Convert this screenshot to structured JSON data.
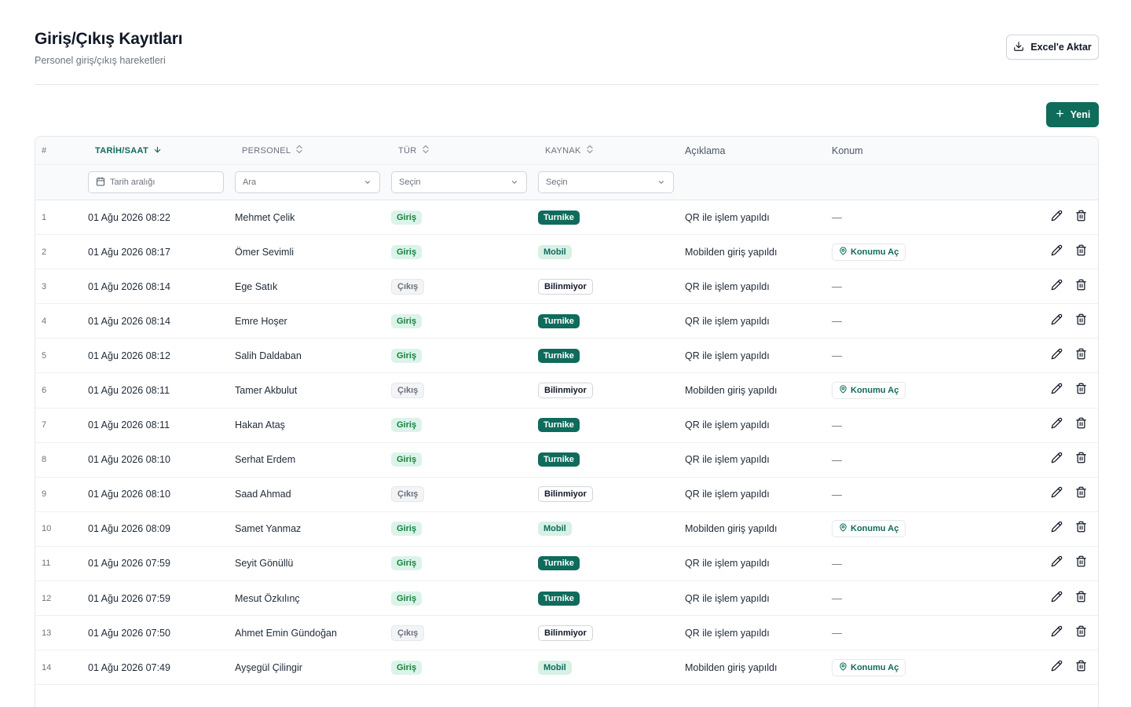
{
  "header": {
    "title": "Giriş/Çıkış Kayıtları",
    "subtitle": "Personel giriş/çıkış hareketleri",
    "export_label": "Excel'e Aktar",
    "new_label": "Yeni"
  },
  "columns": {
    "index": "#",
    "datetime": "TARİH/SAAT",
    "person": "PERSONEL",
    "type": "TÜR",
    "source": "KAYNAK",
    "description": "Açıklama",
    "location": "Konum"
  },
  "filters": {
    "date_placeholder": "Tarih aralığı",
    "person_placeholder": "Ara",
    "type_placeholder": "Seçin",
    "source_placeholder": "Seçin"
  },
  "icons": {
    "export": "download-icon",
    "new": "plus-icon",
    "sort_active": "arrow-down-icon",
    "sort": "sort-icon",
    "calendar": "calendar-icon",
    "dropdown": "chevron-down-icon",
    "location": "map-pin-icon",
    "edit": "pencil-icon",
    "delete": "trash-icon"
  },
  "colors": {
    "primary": "#0f6b5c",
    "giris_bg": "#dcf3ea",
    "giris_text": "#15803d",
    "mobil_bg": "#d7f1e4"
  },
  "rows": [
    {
      "index": "1",
      "datetime": "01 Ağu 2026 08:22",
      "person": "Mehmet Çelik",
      "type": "Giriş",
      "source": "Turnike",
      "description": "QR ile işlem yapıldı",
      "location": "—"
    },
    {
      "index": "2",
      "datetime": "01 Ağu 2026 08:17",
      "person": "Ömer Sevimli",
      "type": "Giriş",
      "source": "Mobil",
      "description": "Mobilden giriş yapıldı",
      "location": "Konumu Aç"
    },
    {
      "index": "3",
      "datetime": "01 Ağu 2026 08:14",
      "person": "Ege Satık",
      "type": "Çıkış",
      "source": "Bilinmiyor",
      "description": "QR ile işlem yapıldı",
      "location": "—"
    },
    {
      "index": "4",
      "datetime": "01 Ağu 2026 08:14",
      "person": "Emre Hoşer",
      "type": "Giriş",
      "source": "Turnike",
      "description": "QR ile işlem yapıldı",
      "location": "—"
    },
    {
      "index": "5",
      "datetime": "01 Ağu 2026 08:12",
      "person": "Salih Daldaban",
      "type": "Giriş",
      "source": "Turnike",
      "description": "QR ile işlem yapıldı",
      "location": "—"
    },
    {
      "index": "6",
      "datetime": "01 Ağu 2026 08:11",
      "person": "Tamer Akbulut",
      "type": "Çıkış",
      "source": "Bilinmiyor",
      "description": "Mobilden giriş yapıldı",
      "location": "Konumu Aç"
    },
    {
      "index": "7",
      "datetime": "01 Ağu 2026 08:11",
      "person": "Hakan Ataş",
      "type": "Giriş",
      "source": "Turnike",
      "description": "QR ile işlem yapıldı",
      "location": "—"
    },
    {
      "index": "8",
      "datetime": "01 Ağu 2026 08:10",
      "person": "Serhat Erdem",
      "type": "Giriş",
      "source": "Turnike",
      "description": "QR ile işlem yapıldı",
      "location": "—"
    },
    {
      "index": "9",
      "datetime": "01 Ağu 2026 08:10",
      "person": "Saad Ahmad",
      "type": "Çıkış",
      "source": "Bilinmiyor",
      "description": "QR ile işlem yapıldı",
      "location": "—"
    },
    {
      "index": "10",
      "datetime": "01 Ağu 2026 08:09",
      "person": "Samet Yanmaz",
      "type": "Giriş",
      "source": "Mobil",
      "description": "Mobilden giriş yapıldı",
      "location": "Konumu Aç"
    },
    {
      "index": "11",
      "datetime": "01 Ağu 2026 07:59",
      "person": "Seyit Gönüllü",
      "type": "Giriş",
      "source": "Turnike",
      "description": "QR ile işlem yapıldı",
      "location": "—"
    },
    {
      "index": "12",
      "datetime": "01 Ağu 2026 07:59",
      "person": "Mesut Özkılınç",
      "type": "Giriş",
      "source": "Turnike",
      "description": "QR ile işlem yapıldı",
      "location": "—"
    },
    {
      "index": "13",
      "datetime": "01 Ağu 2026 07:50",
      "person": "Ahmet Emin Gündoğan",
      "type": "Çıkış",
      "source": "Bilinmiyor",
      "description": "QR ile işlem yapıldı",
      "location": "—"
    },
    {
      "index": "14",
      "datetime": "01 Ağu 2026 07:49",
      "person": "Ayşegül Çilingir",
      "type": "Giriş",
      "source": "Mobil",
      "description": "Mobilden giriş yapıldı",
      "location": "Konumu Aç"
    }
  ]
}
